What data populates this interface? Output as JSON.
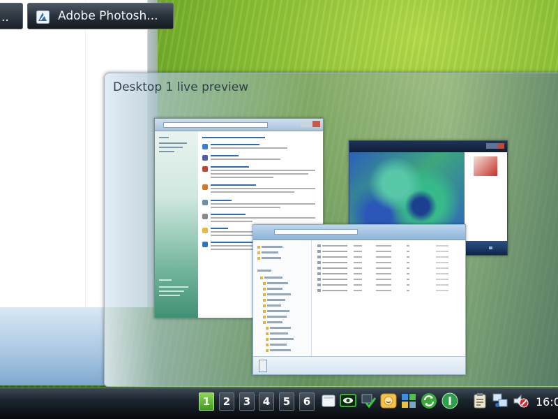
{
  "preview": {
    "title": "Desktop 1 live preview"
  },
  "taskbar": {
    "prev_label": "..",
    "photoshop_label": "Adobe Photosh...",
    "desktops": [
      "1",
      "2",
      "3",
      "4",
      "5",
      "6"
    ],
    "active_desktop": "1",
    "clock": "16:0"
  },
  "colors": {
    "active_desktop": "#3c9a1c",
    "taskbar": "#1b242d",
    "wallpaper": "#7fb82f"
  },
  "icons": {
    "quicklaunch": [
      "desktop-show-icon",
      "eye-monitor-icon",
      "checkmark-window-icon",
      "messenger-icon",
      "app-grid-icon",
      "sync-arrows-icon",
      "green-info-icon"
    ],
    "tray": [
      "clipboard-icon",
      "network-icon",
      "volume-muted-icon"
    ]
  }
}
